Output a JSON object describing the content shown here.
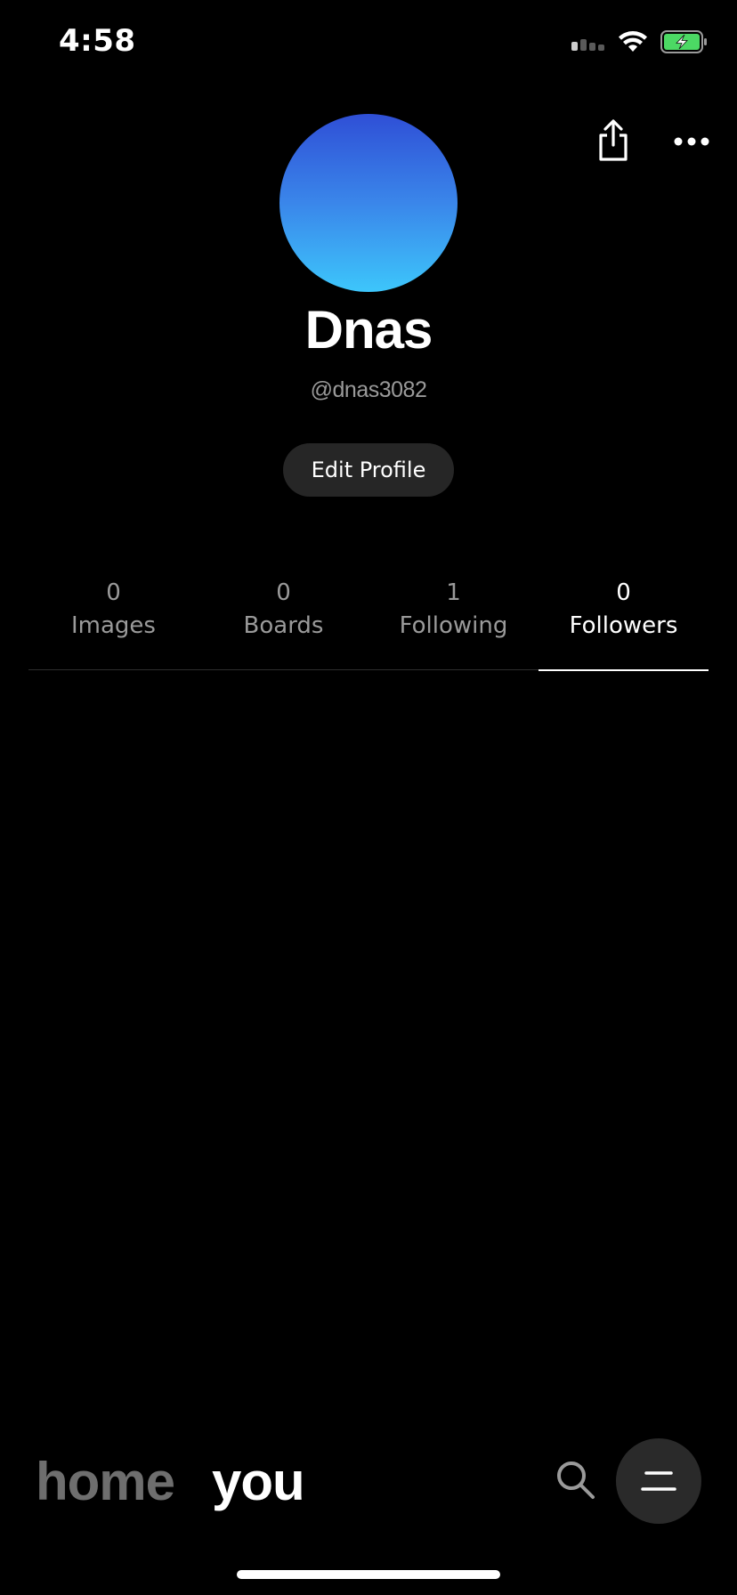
{
  "status_bar": {
    "time": "4:58",
    "icons": [
      "cellular-signal-icon",
      "wifi-icon",
      "battery-charging-icon"
    ],
    "battery_color": "#4cd964"
  },
  "top_actions": {
    "share_icon": "share-icon",
    "more_icon": "more-horizontal-icon"
  },
  "profile": {
    "display_name": "Dnas",
    "username": "@dnas3082",
    "avatar_gradient": [
      "#2f4fd6",
      "#3a86ea",
      "#3dc6fb"
    ],
    "edit_button_label": "Edit Profile"
  },
  "stats_tabs": [
    {
      "count": "0",
      "label": "Images",
      "active": false
    },
    {
      "count": "0",
      "label": "Boards",
      "active": false
    },
    {
      "count": "1",
      "label": "Following",
      "active": false
    },
    {
      "count": "0",
      "label": "Followers",
      "active": true
    }
  ],
  "bottom_nav": {
    "home_label": "home",
    "you_label": "you",
    "search_icon": "search-icon",
    "menu_icon": "menu-icon"
  }
}
